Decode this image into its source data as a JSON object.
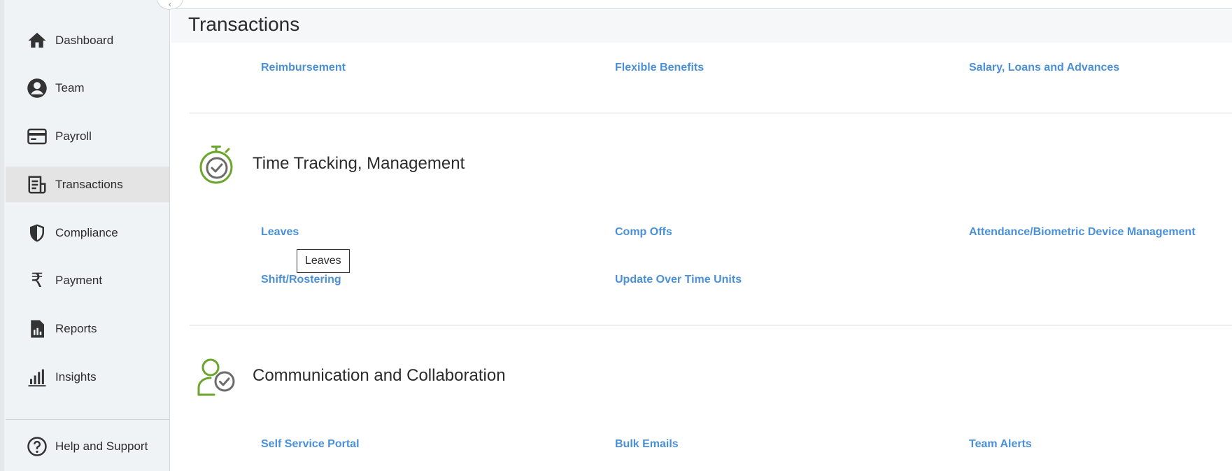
{
  "sidebar": {
    "items": [
      {
        "label": "Dashboard",
        "icon": "home-icon"
      },
      {
        "label": "Team",
        "icon": "user-circle-icon"
      },
      {
        "label": "Payroll",
        "icon": "credit-card-icon"
      },
      {
        "label": "Transactions",
        "icon": "receipt-icon",
        "active": true
      },
      {
        "label": "Compliance",
        "icon": "shield-icon"
      },
      {
        "label": "Payment",
        "icon": "rupee-icon"
      },
      {
        "label": "Reports",
        "icon": "report-file-icon"
      },
      {
        "label": "Insights",
        "icon": "bar-chart-icon"
      }
    ],
    "help": {
      "label": "Help and Support",
      "icon": "help-circle-icon"
    }
  },
  "page": {
    "title": "Transactions"
  },
  "sections": {
    "payroll_links": [
      "Reimbursement",
      "Flexible Benefits",
      "Salary, Loans and Advances"
    ],
    "time": {
      "title": "Time Tracking, Management",
      "icon": "stopwatch-check-icon",
      "links": [
        "Leaves",
        "Comp Offs",
        "Attendance/Biometric Device Management",
        "Shift/Rostering",
        "Update Over Time Units"
      ]
    },
    "comm": {
      "title": "Communication and Collaboration",
      "icon": "user-check-icon",
      "links": [
        "Self Service Portal",
        "Bulk Emails",
        "Team Alerts"
      ]
    }
  },
  "tooltip": {
    "text": "Leaves"
  },
  "colors": {
    "link": "#4a90d9",
    "icon_green": "#6aa62c",
    "icon_gray": "#6b6b6b",
    "sidebar_bg": "#eff3f5",
    "active_bg": "#e4e4e4"
  }
}
